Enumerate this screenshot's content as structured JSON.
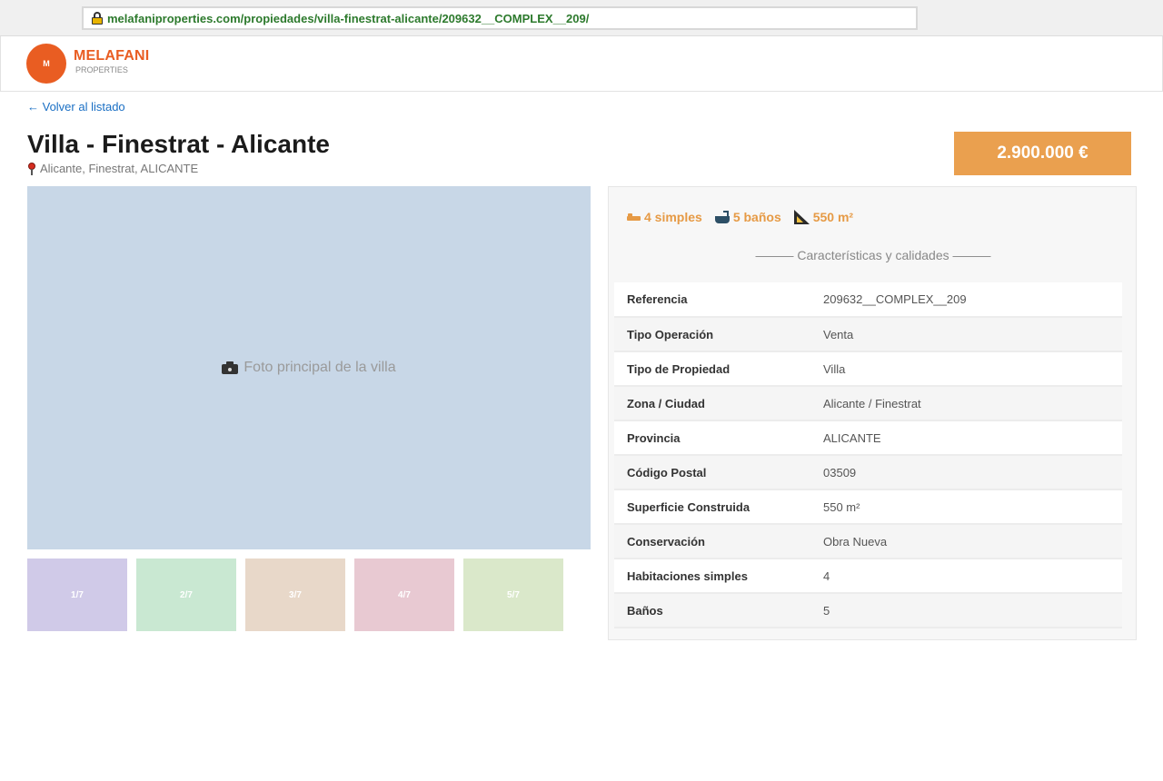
{
  "browser": {
    "url": "melafaniproperties.com/propiedades/villa-finestrat-alicante/209632__COMPLEX__209/"
  },
  "header": {
    "logo_initial": "M",
    "brand_name": "MELAFANI",
    "brand_sub": "PROPERTIES",
    "brand_color": "#e95d22"
  },
  "back_link": "← Volver al listado",
  "listing": {
    "title": "Villa - Finestrat - Alicante",
    "location": "Alicante, Finestrat, ALICANTE",
    "price": "2.900.000 €",
    "price_color": "#eaa04f"
  },
  "gallery": {
    "main_label": "Foto principal de la villa",
    "thumbnails": [
      {
        "label": "1/7",
        "color": "#d0cae8"
      },
      {
        "label": "2/7",
        "color": "#c9e8d2"
      },
      {
        "label": "3/7",
        "color": "#e8d8c9"
      },
      {
        "label": "4/7",
        "color": "#e8c9d2"
      },
      {
        "label": "5/7",
        "color": "#dae8ca"
      }
    ]
  },
  "summary": {
    "bedrooms": "4 simples",
    "bathrooms": "5 baños",
    "area": "550 m²",
    "icons": [
      "bed-icon",
      "bath-icon",
      "area-icon"
    ]
  },
  "specs": {
    "section_title": "——— Características y calidades ———",
    "rows": [
      {
        "label": "Referencia",
        "value": "209632__COMPLEX__209"
      },
      {
        "label": "Tipo Operación",
        "value": "Venta"
      },
      {
        "label": "Tipo de Propiedad",
        "value": "Villa"
      },
      {
        "label": "Zona / Ciudad",
        "value": "Alicante / Finestrat"
      },
      {
        "label": "Provincia",
        "value": "ALICANTE"
      },
      {
        "label": "Código Postal",
        "value": "03509"
      },
      {
        "label": "Superficie Construida",
        "value": "550 m²"
      },
      {
        "label": "Conservación",
        "value": "Obra Nueva"
      },
      {
        "label": "Habitaciones simples",
        "value": "4"
      },
      {
        "label": "Baños",
        "value": "5"
      }
    ]
  }
}
